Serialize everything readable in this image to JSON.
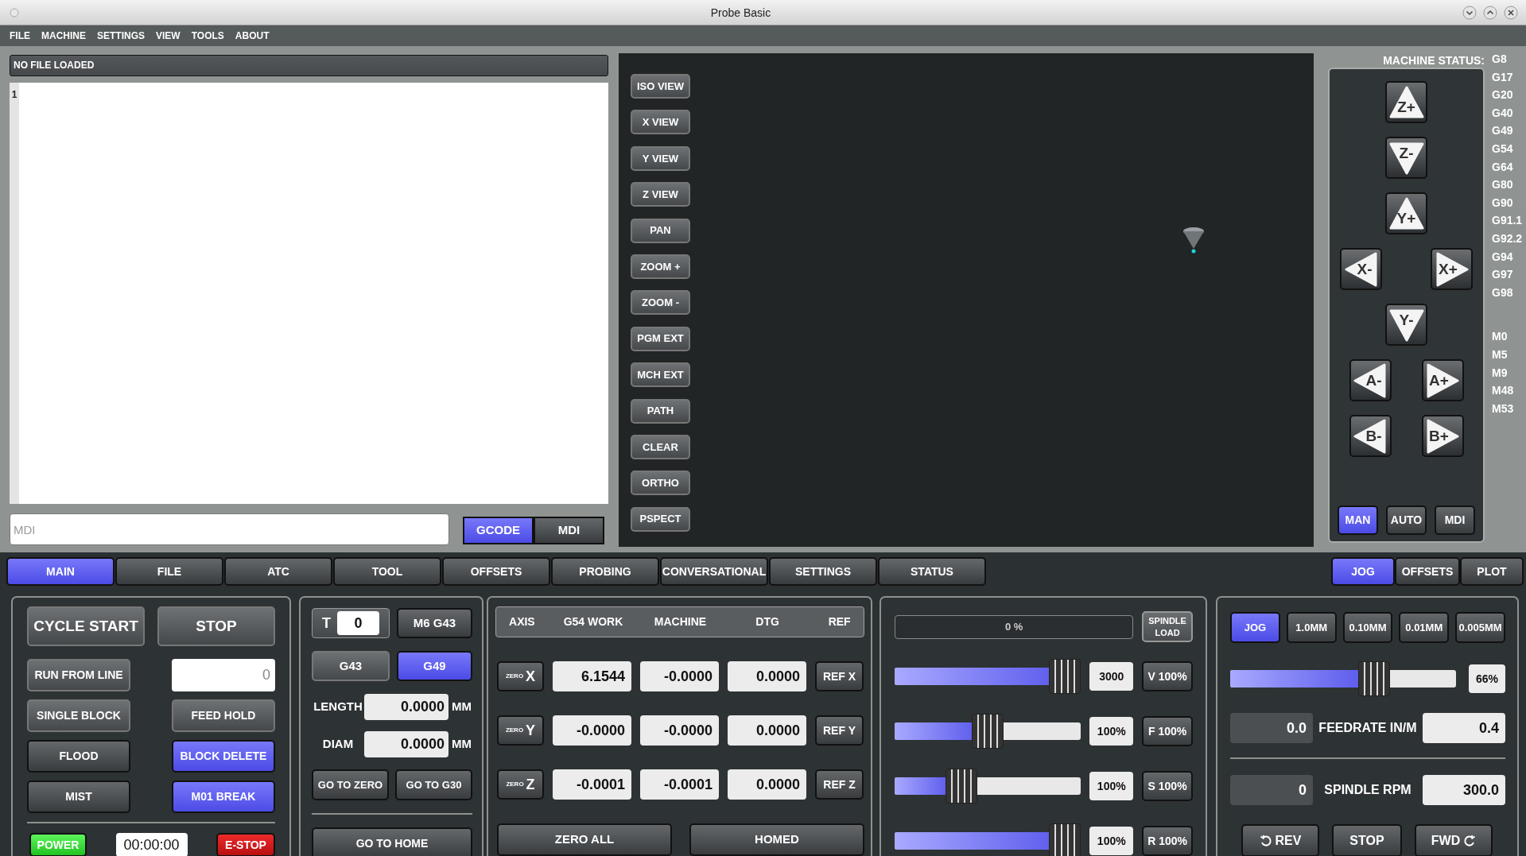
{
  "window": {
    "title": "Probe Basic"
  },
  "menu": [
    "FILE",
    "MACHINE",
    "SETTINGS",
    "VIEW",
    "TOOLS",
    "ABOUT"
  ],
  "file_header": "NO FILE LOADED",
  "editor": {
    "line_numbers": [
      "1"
    ]
  },
  "mdi_field": {
    "placeholder": "MDI"
  },
  "editor_mode_tabs": [
    {
      "label": "GCODE",
      "selected": true
    },
    {
      "label": "MDI",
      "selected": false
    }
  ],
  "view_buttons": [
    "ISO VIEW",
    "X VIEW",
    "Y VIEW",
    "Z VIEW",
    "PAN",
    "ZOOM +",
    "ZOOM -",
    "PGM EXT",
    "MCH EXT",
    "PATH",
    "CLEAR",
    "ORTHO",
    "PSPECT"
  ],
  "machine_status": {
    "label": "MACHINE STATUS:",
    "g_codes": [
      "G8",
      "G17",
      "G20",
      "G40",
      "G49",
      "G54",
      "G64",
      "G80",
      "G90",
      "G91.1",
      "G92.2",
      "G94",
      "G97",
      "G98"
    ],
    "m_codes": [
      "M0",
      "M5",
      "M9",
      "M48",
      "M53"
    ]
  },
  "jog_buttons": [
    {
      "label": "Z+",
      "kind": "up"
    },
    {
      "label": "Z-",
      "kind": "down"
    },
    {
      "label": "Y+",
      "kind": "up"
    },
    {
      "label": "X-",
      "kind": "left"
    },
    {
      "label": "X+",
      "kind": "right"
    },
    {
      "label": "Y-",
      "kind": "down"
    },
    {
      "label": "A-",
      "kind": "left"
    },
    {
      "label": "A+",
      "kind": "right"
    },
    {
      "label": "B-",
      "kind": "left"
    },
    {
      "label": "B+",
      "kind": "right"
    }
  ],
  "jog_modes": [
    {
      "label": "MAN",
      "selected": true
    },
    {
      "label": "AUTO",
      "selected": false
    },
    {
      "label": "MDI",
      "selected": false
    }
  ],
  "main_tabs": [
    {
      "label": "MAIN",
      "selected": true
    },
    {
      "label": "FILE",
      "selected": false
    },
    {
      "label": "ATC",
      "selected": false
    },
    {
      "label": "TOOL",
      "selected": false
    },
    {
      "label": "OFFSETS",
      "selected": false
    },
    {
      "label": "PROBING",
      "selected": false
    },
    {
      "label": "CONVERSATIONAL",
      "selected": false
    },
    {
      "label": "SETTINGS",
      "selected": false
    },
    {
      "label": "STATUS",
      "selected": false
    }
  ],
  "side_tabs": [
    {
      "label": "JOG",
      "selected": true
    },
    {
      "label": "OFFSETS",
      "selected": false
    },
    {
      "label": "PLOT",
      "selected": false
    }
  ],
  "program_panel": {
    "cycle_start": "CYCLE START",
    "stop": "STOP",
    "run_from_line": {
      "label": "RUN FROM LINE",
      "placeholder": "0"
    },
    "toggles": [
      {
        "label": "SINGLE BLOCK",
        "on": false
      },
      {
        "label": "FEED HOLD",
        "on": false
      },
      {
        "label": "FLOOD",
        "on": false
      },
      {
        "label": "BLOCK DELETE",
        "on": true
      },
      {
        "label": "MIST",
        "on": false
      },
      {
        "label": "M01 BREAK",
        "on": true
      }
    ],
    "power": {
      "label": "POWER",
      "on": true
    },
    "timer": "00:00:00",
    "estop": {
      "label": "E-STOP",
      "on": true
    }
  },
  "tool_panel": {
    "tool_label": "T",
    "tool_number": "0",
    "load_button": "M6 G43",
    "offset_modes": [
      {
        "label": "G43",
        "selected": false
      },
      {
        "label": "G49",
        "selected": true
      }
    ],
    "length": {
      "label": "LENGTH",
      "value": "0.0000",
      "unit": "MM"
    },
    "diameter": {
      "label": "DIAM",
      "value": "0.0000",
      "unit": "MM"
    },
    "go_buttons": [
      "GO TO ZERO",
      "GO TO G30"
    ],
    "home_button": "GO TO HOME"
  },
  "dro_panel": {
    "columns": [
      "AXIS",
      "G54 WORK",
      "MACHINE",
      "DTG",
      "REF"
    ],
    "rows": [
      {
        "zero_label": "ZERO",
        "axis": "X",
        "work": "6.1544",
        "machine": "-0.0000",
        "dtg": "0.0000",
        "ref": "REF X"
      },
      {
        "zero_label": "ZERO",
        "axis": "Y",
        "work": "-0.0000",
        "machine": "-0.0000",
        "dtg": "0.0000",
        "ref": "REF Y"
      },
      {
        "zero_label": "ZERO",
        "axis": "Z",
        "work": "-0.0001",
        "machine": "-0.0001",
        "dtg": "0.0000",
        "ref": "REF Z"
      }
    ],
    "buttons": [
      "ZERO ALL",
      "HOMED"
    ]
  },
  "override_panel": {
    "spindle_load": {
      "level": 0,
      "reading": "0 %",
      "label": "SPINDLE LOAD"
    },
    "sliders": [
      {
        "level": 1.0,
        "value": "3000",
        "button": "V 100%"
      },
      {
        "level": 0.5,
        "value": "100%",
        "button": "F 100%"
      },
      {
        "level": 0.33,
        "value": "100%",
        "button": "S 100%"
      },
      {
        "level": 1.0,
        "value": "100%",
        "button": "R 100%"
      }
    ]
  },
  "jog_panel": {
    "increments": [
      {
        "label": "JOG",
        "selected": true
      },
      {
        "label": "1.0MM",
        "selected": false
      },
      {
        "label": "0.10MM",
        "selected": false
      },
      {
        "label": "0.01MM",
        "selected": false
      },
      {
        "label": "0.005MM",
        "selected": false
      }
    ],
    "jog_speed": {
      "level": 0.66,
      "reading": "66%"
    },
    "feedrate": {
      "value": "0.0",
      "label": "FEEDRATE IN/M",
      "setting": "0.4"
    },
    "spindle": {
      "value": "0",
      "label": "SPINDLE RPM",
      "setting": "300.0"
    },
    "spindle_buttons": [
      {
        "label": "REV",
        "kind": "reverse"
      },
      {
        "label": "STOP",
        "kind": "stop"
      },
      {
        "label": "FWD",
        "kind": "forward"
      }
    ]
  }
}
